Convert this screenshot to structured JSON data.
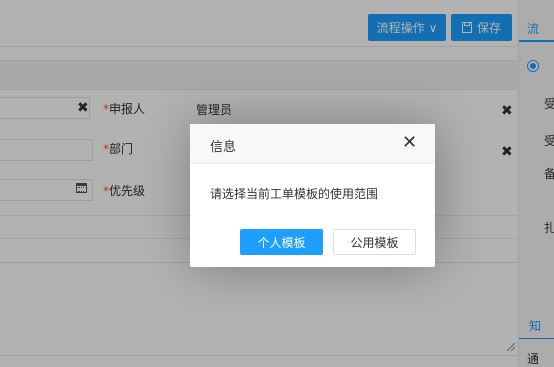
{
  "toolbar": {
    "flow_label": "流程操作",
    "flow_caret": "∨",
    "save_label": "保存",
    "save_icon": "save-icon"
  },
  "form": {
    "reporter": {
      "label": "申报人",
      "value": "管理员",
      "required": true
    },
    "department": {
      "label": "部门",
      "required": true
    },
    "priority": {
      "label": "优先级",
      "required": true
    },
    "clear_glyph": "✖"
  },
  "side_panel": {
    "tab_label": "流",
    "row1_label": "受",
    "row2_label": "受",
    "row3_label": "备",
    "row4_label": "扎",
    "section_label": "知",
    "section_item": "通"
  },
  "dialog": {
    "title": "信息",
    "close_glyph": "✕",
    "message": "请选择当前工单模板的使用范围",
    "primary_button": "个人模板",
    "secondary_button": "公用模板"
  },
  "colors": {
    "accent": "#1e9fff",
    "required": "#ff5722",
    "overlay": "rgba(0,0,0,0.3)"
  }
}
